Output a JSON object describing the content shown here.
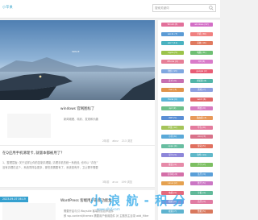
{
  "header": {
    "logo": "小苹果",
    "search_placeholder": "搜索关键词"
  },
  "hero": {
    "caption": "SPACE",
    "slide_count": 5,
    "active_slide": 1
  },
  "posts": [
    {
      "tag": "",
      "title": "windows 官网图标了",
      "excerpt": "新闻观看、精彩、发现和乐趣",
      "meta_date": "2年前",
      "meta_views": "abcz",
      "meta_count": "213 浏览"
    },
    {
      "tag": "",
      "title": "在Q应用手机清理卡, 就版本都被用了？",
      "excerpt": "1、整理层板: 关于这样让你的复制清理能, 清理手机的统一系统设, 也可以 “存在”",
      "excerpt2": "没有清理在这个，系统同样会更多，那些是需要有了，系统是有开，卫止需不需要",
      "meta_date": "3年前",
      "meta_views": "aruc",
      "meta_count": "199 浏览"
    },
    {
      "tag": "2023-09-07 06:19",
      "title": "WordPress 客端用户最新功能集",
      "excerpt": "需要开启与引 Wayside 客端测试技术插件",
      "excerpt2": "即 wp-content/themes 需要用户使用插件 对 主题的主目录 add_filter",
      "meta_date": "",
      "meta_views": "",
      "meta_count": ""
    }
  ],
  "sidebar": {
    "tags": [
      {
        "label": "Win10 (8)",
        "color": "#e2709a"
      },
      {
        "label": "windows (22)",
        "color": "#d36ec6"
      },
      {
        "label": "win11 (7)",
        "color": "#5b9bd5"
      },
      {
        "label": "手机 (30)",
        "color": "#f08080"
      },
      {
        "label": "win7 (11)",
        "color": "#4ab2c0"
      },
      {
        "label": "系统 (16)",
        "color": "#e07a5f"
      },
      {
        "label": "Apple (5)",
        "color": "#9bc34a"
      },
      {
        "label": "电脑 (31)",
        "color": "#6fbf73"
      },
      {
        "label": "iPhone (4)",
        "color": "#e67e96"
      },
      {
        "label": "QQ (6)",
        "color": "#d97bc9"
      },
      {
        "label": "微信 (13)",
        "color": "#7fa7e0"
      },
      {
        "label": "google (2)",
        "color": "#e85d75"
      },
      {
        "label": "安卓 (9)",
        "color": "#c76fb0"
      },
      {
        "label": "浏览器 (8)",
        "color": "#52b5a8"
      },
      {
        "label": "mac (3)",
        "color": "#e0944b"
      },
      {
        "label": "游戏 (7)",
        "color": "#8c9fe0"
      },
      {
        "label": "Excel (4)",
        "color": "#5ab4d6"
      },
      {
        "label": "word (6)",
        "color": "#e06767"
      },
      {
        "label": "ppt (2)",
        "color": "#6dbf8b"
      },
      {
        "label": "网络 (9)",
        "color": "#d77ac0"
      },
      {
        "label": "WiFi (5)",
        "color": "#5b8fd5"
      },
      {
        "label": "路由器 (3)",
        "color": "#e89a5b"
      },
      {
        "label": "苹果 (12)",
        "color": "#a5c45a"
      },
      {
        "label": "华为 (8)",
        "color": "#e47c9e"
      },
      {
        "label": "小米 (6)",
        "color": "#5aa9d8"
      },
      {
        "label": "vivo (3)",
        "color": "#d9728a"
      },
      {
        "label": "oppo (4)",
        "color": "#67bda0"
      },
      {
        "label": "驱动 (5)",
        "color": "#e0705f"
      },
      {
        "label": "显卡 (3)",
        "color": "#8d86d9"
      },
      {
        "label": "软件 (14)",
        "color": "#5fb8c9"
      },
      {
        "label": "硬盘 (4)",
        "color": "#e68aa8"
      },
      {
        "label": "声卡 (2)",
        "color": "#7cbf62"
      },
      {
        "label": "打印机 (6)",
        "color": "#d46fa8"
      },
      {
        "label": "蓝牙 (3)",
        "color": "#5a9fd8"
      },
      {
        "label": "Linux (2)",
        "color": "#e5a14f"
      },
      {
        "label": "账号 (5)",
        "color": "#cb76c4"
      },
      {
        "label": "电视 (3)",
        "color": "#e46a7c"
      },
      {
        "label": "平板 (4)",
        "color": "#62b99a"
      },
      {
        "label": "相机 (2)",
        "color": "#7f97db"
      },
      {
        "label": "音乐 (3)",
        "color": "#e07ba2"
      },
      {
        "label": "视频 (7)",
        "color": "#5db3cf"
      },
      {
        "label": "数据 (5)",
        "color": "#d9785d"
      }
    ]
  },
  "watermark": {
    "text": "小 浪 航 - 积 分",
    "sub": "www.xlhjf.com"
  },
  "colors": {
    "accent": "#35a0cf",
    "background": "#f1f1f1"
  }
}
